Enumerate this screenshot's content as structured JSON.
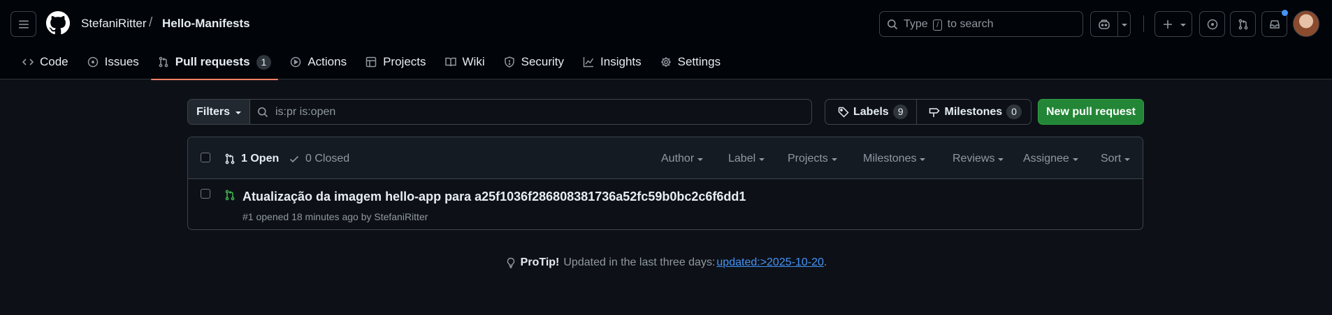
{
  "header": {
    "owner": "StefaniRitter",
    "separator": "/",
    "repo": "Hello-Manifests",
    "search_prefix": "Type",
    "search_key": "/",
    "search_suffix": "to search"
  },
  "tabs": [
    {
      "label": "Code",
      "icon": "code-icon"
    },
    {
      "label": "Issues",
      "icon": "issue-opened-icon"
    },
    {
      "label": "Pull requests",
      "icon": "git-pull-request-icon",
      "count": "1",
      "active": true
    },
    {
      "label": "Actions",
      "icon": "play-icon"
    },
    {
      "label": "Projects",
      "icon": "table-icon"
    },
    {
      "label": "Wiki",
      "icon": "book-icon"
    },
    {
      "label": "Security",
      "icon": "shield-icon"
    },
    {
      "label": "Insights",
      "icon": "graph-icon"
    },
    {
      "label": "Settings",
      "icon": "gear-icon"
    }
  ],
  "toolbar": {
    "filters_label": "Filters",
    "search_value": "is:pr is:open",
    "labels_label": "Labels",
    "labels_count": "9",
    "milestones_label": "Milestones",
    "milestones_count": "0",
    "new_pr_label": "New pull request"
  },
  "list": {
    "open_label": "1 Open",
    "closed_label": "0 Closed",
    "sorters": [
      "Author",
      "Label",
      "Projects",
      "Milestones",
      "Reviews",
      "Assignee",
      "Sort"
    ],
    "items": [
      {
        "title": "Atualização da imagem hello-app para a25f1036f286808381736a52fc59b0bc2c6f6dd1",
        "meta": "#1 opened 18 minutes ago by StefaniRitter"
      }
    ]
  },
  "protip": {
    "label": "ProTip!",
    "text": "Updated in the last three days:",
    "link": "updated:>2025-10-20",
    "end": "."
  },
  "colors": {
    "background": "#0d1117",
    "header_bg": "#010409",
    "accent_underline": "#f78166",
    "primary_button": "#238636",
    "link": "#4493f8",
    "open_icon": "#3fb950"
  }
}
